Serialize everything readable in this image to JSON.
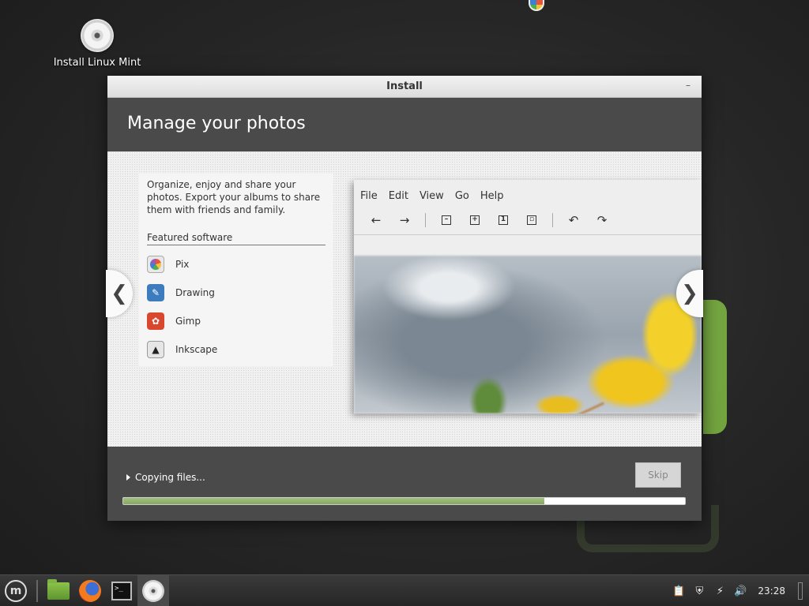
{
  "desktop": {
    "icon_label": "Install Linux Mint"
  },
  "window": {
    "title": "Install",
    "minimize_glyph": "–",
    "header_title": "Manage your photos"
  },
  "slide": {
    "description": "Organize, enjoy and share your photos. Export your albums to share them with friends and family.",
    "featured_title": "Featured software",
    "apps": [
      {
        "label": "Pix",
        "icon": "pix-icon"
      },
      {
        "label": "Drawing",
        "icon": "drawing-icon"
      },
      {
        "label": "Gimp",
        "icon": "gimp-icon"
      },
      {
        "label": "Inkscape",
        "icon": "inkscape-icon"
      }
    ],
    "screenshot_menu": [
      "File",
      "Edit",
      "View",
      "Go",
      "Help"
    ],
    "prev_glyph": "❮",
    "next_glyph": "❯"
  },
  "footer": {
    "status": "Copying files...",
    "skip_label": "Skip",
    "progress": 0.75
  },
  "taskbar": {
    "clock": "23:28"
  },
  "colors": {
    "progress_fill": "#87a862",
    "header_bg": "#4a4a4a"
  }
}
